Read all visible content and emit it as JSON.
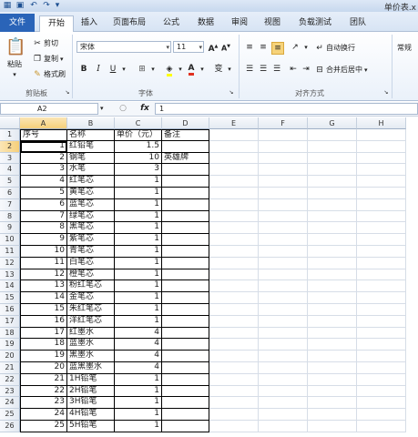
{
  "window": {
    "title": "单价表.x"
  },
  "ribbon_tabs": [
    "文件",
    "开始",
    "插入",
    "页面布局",
    "公式",
    "数据",
    "审阅",
    "视图",
    "负载测试",
    "团队"
  ],
  "clipboard": {
    "paste": "粘贴",
    "cut": "剪切",
    "copy": "复制",
    "format_painter": "格式刷",
    "group": "剪贴板"
  },
  "font": {
    "name": "宋体",
    "size": "11",
    "group": "字体",
    "bold": "B",
    "italic": "I",
    "underline": "U",
    "grow": "A",
    "shrink": "A",
    "color_letter": "A",
    "wen": "变"
  },
  "alignment": {
    "wrap": "自动换行",
    "merge": "合并后居中",
    "group": "对齐方式"
  },
  "number": {
    "format": "常规"
  },
  "formula_bar": {
    "name_box": "A2",
    "fx": "fx",
    "value": "1"
  },
  "columns": [
    "A",
    "B",
    "C",
    "D",
    "E",
    "F",
    "G",
    "H"
  ],
  "rows": [
    {
      "n": "1",
      "a": "序号",
      "b": "名称",
      "c": "单价（元）",
      "d": "备注"
    },
    {
      "n": "2",
      "a": "1",
      "b": "红铅笔",
      "c": "1.5",
      "d": ""
    },
    {
      "n": "3",
      "a": "2",
      "b": "钢笔",
      "c": "10",
      "d": "英雄牌"
    },
    {
      "n": "4",
      "a": "3",
      "b": "水笔",
      "c": "3",
      "d": ""
    },
    {
      "n": "5",
      "a": "4",
      "b": "红笔芯",
      "c": "1",
      "d": ""
    },
    {
      "n": "6",
      "a": "5",
      "b": "黄笔芯",
      "c": "1",
      "d": ""
    },
    {
      "n": "7",
      "a": "6",
      "b": "蓝笔芯",
      "c": "1",
      "d": ""
    },
    {
      "n": "8",
      "a": "7",
      "b": "绿笔芯",
      "c": "1",
      "d": ""
    },
    {
      "n": "9",
      "a": "8",
      "b": "黑笔芯",
      "c": "1",
      "d": ""
    },
    {
      "n": "10",
      "a": "9",
      "b": "紫笔芯",
      "c": "1",
      "d": ""
    },
    {
      "n": "11",
      "a": "10",
      "b": "青笔芯",
      "c": "1",
      "d": ""
    },
    {
      "n": "12",
      "a": "11",
      "b": "白笔芯",
      "c": "1",
      "d": ""
    },
    {
      "n": "13",
      "a": "12",
      "b": "橙笔芯",
      "c": "1",
      "d": ""
    },
    {
      "n": "14",
      "a": "13",
      "b": "粉红笔芯",
      "c": "1",
      "d": ""
    },
    {
      "n": "15",
      "a": "14",
      "b": "金笔芯",
      "c": "1",
      "d": ""
    },
    {
      "n": "16",
      "a": "15",
      "b": "朱红笔芯",
      "c": "1",
      "d": ""
    },
    {
      "n": "17",
      "a": "16",
      "b": "洋红笔芯",
      "c": "1",
      "d": ""
    },
    {
      "n": "18",
      "a": "17",
      "b": "红墨水",
      "c": "4",
      "d": ""
    },
    {
      "n": "19",
      "a": "18",
      "b": "蓝墨水",
      "c": "4",
      "d": ""
    },
    {
      "n": "20",
      "a": "19",
      "b": "黑墨水",
      "c": "4",
      "d": ""
    },
    {
      "n": "21",
      "a": "20",
      "b": "蓝黑墨水",
      "c": "4",
      "d": ""
    },
    {
      "n": "22",
      "a": "21",
      "b": "1H铅笔",
      "c": "1",
      "d": ""
    },
    {
      "n": "23",
      "a": "22",
      "b": "2H铅笔",
      "c": "1",
      "d": ""
    },
    {
      "n": "24",
      "a": "23",
      "b": "3H铅笔",
      "c": "1",
      "d": ""
    },
    {
      "n": "25",
      "a": "24",
      "b": "4H铅笔",
      "c": "1",
      "d": ""
    },
    {
      "n": "26",
      "a": "25",
      "b": "5H铅笔",
      "c": "1",
      "d": ""
    }
  ],
  "colors": {
    "file_tab": "#2a64b8",
    "selection_header": "#f5cf7a"
  }
}
